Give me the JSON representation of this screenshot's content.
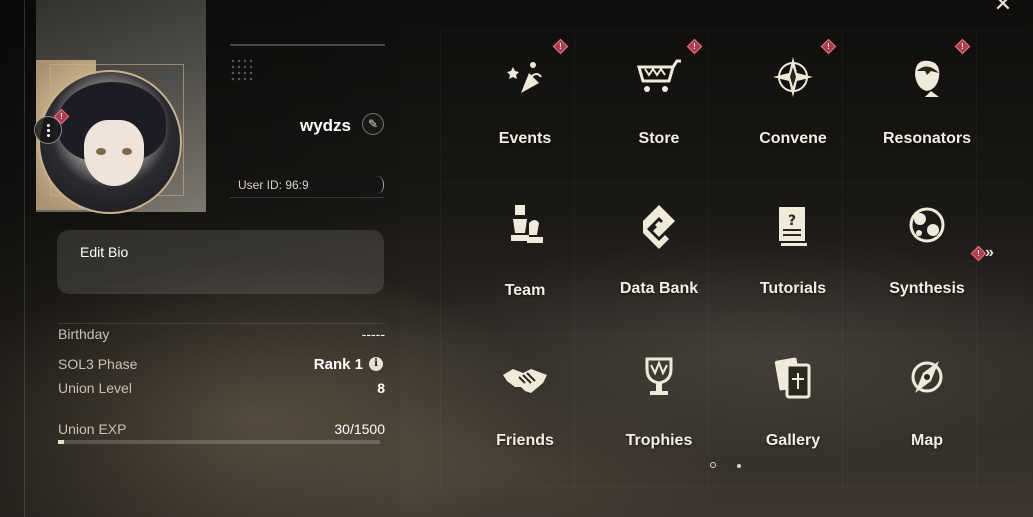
{
  "profile": {
    "username": "wydzs",
    "user_id_label": "User ID: 96:9",
    "bio_label": "Edit Bio"
  },
  "stats": {
    "birthday": {
      "label": "Birthday",
      "value": "-----"
    },
    "sol3_phase": {
      "label": "SOL3 Phase",
      "value": "Rank 1"
    },
    "union_level": {
      "label": "Union Level",
      "value": "8"
    },
    "union_exp": {
      "label": "Union EXP",
      "value": "30/1500",
      "progress": 0.02
    }
  },
  "menu": [
    {
      "label": "Events",
      "icon": "events-icon",
      "alert": true
    },
    {
      "label": "Store",
      "icon": "cart-icon",
      "alert": true
    },
    {
      "label": "Convene",
      "icon": "compass-star-icon",
      "alert": true
    },
    {
      "label": "Resonators",
      "icon": "character-portrait-icon",
      "alert": true
    },
    {
      "label": "Team",
      "icon": "chess-pieces-icon",
      "alert": false
    },
    {
      "label": "Data Bank",
      "icon": "data-bank-icon",
      "alert": false
    },
    {
      "label": "Tutorials",
      "icon": "tutorial-book-icon",
      "alert": false
    },
    {
      "label": "Synthesis",
      "icon": "synthesis-icon",
      "alert": false
    },
    {
      "label": "Friends",
      "icon": "handshake-icon",
      "alert": false
    },
    {
      "label": "Trophies",
      "icon": "trophy-icon",
      "alert": false
    },
    {
      "label": "Gallery",
      "icon": "cards-icon",
      "alert": false
    },
    {
      "label": "Map",
      "icon": "map-compass-icon",
      "alert": false
    }
  ],
  "colors": {
    "accent": "#c9b28a",
    "alert": "#b23a48",
    "text": "#f4efe4"
  },
  "pagination": {
    "pages": 2,
    "current": 1
  }
}
